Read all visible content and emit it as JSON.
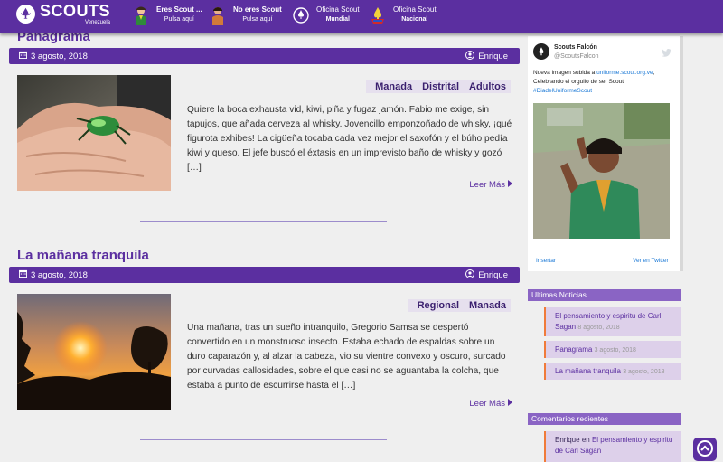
{
  "header": {
    "logo_text": "SCOUTS",
    "logo_sub": "Venezuela",
    "nav": [
      {
        "line1": "Eres Scout ...",
        "line2": "Pulsa aquí",
        "icon": "scout-boy-icon"
      },
      {
        "line1": "No eres Scout",
        "line2": "Pulsa aquí",
        "icon": "child-icon"
      },
      {
        "line1": "Oficina Scout",
        "line2": "Mundial",
        "icon": "world-scout-emblem-icon"
      },
      {
        "line1": "Oficina Scout",
        "line2": "Nacional",
        "icon": "national-scout-emblem-icon"
      }
    ]
  },
  "posts": [
    {
      "title": "Panagrama",
      "date": "3 agosto, 2018",
      "author": "Enrique",
      "tags": [
        "Manada",
        "Distrital",
        "Adultos"
      ],
      "excerpt": "Quiere la boca exhausta vid, kiwi, piña y fugaz jamón. Fabio me exige, sin tapujos, que añada cerveza al whisky. Jovencillo emponzoñado de whisky, ¡qué figurota exhibes! La cigüeña tocaba cada vez mejor el saxofón y el búho pedía kiwi y queso. El jefe buscó el éxtasis en un imprevisto baño de whisky y gozó […]",
      "read_more": "Leer Más"
    },
    {
      "title": "La mañana tranquila",
      "date": "3 agosto, 2018",
      "author": "Enrique",
      "tags": [
        "Regional",
        "Manada"
      ],
      "excerpt": "Una mañana, tras un sueño intranquilo, Gregorio Samsa se despertó convertido en un monstruoso insecto. Estaba echado de espaldas sobre un duro caparazón y, al alzar la cabeza, vio su vientre convexo y oscuro, surcado por curvadas callosidades, sobre el que casi no se aguantaba la colcha, que estaba a punto de escurrirse hasta el […]",
      "read_more": "Leer Más"
    }
  ],
  "twitter": {
    "name": "Scouts Falcón",
    "handle": "@ScoutsFalcon",
    "text_1": "Nueva imagen subida a ",
    "link": "uniforme.scout.org.ve",
    "text_2": ", Celebrando el orgullo de ser Scout",
    "hashtag": "#DiadelUniformeScout",
    "embed": "Insertar",
    "view": "Ver en Twitter"
  },
  "recent_posts": {
    "title": "Ultimas Noticias",
    "items": [
      {
        "title": "El pensamiento y espiritu de Carl Sagan",
        "date": "8 agosto, 2018"
      },
      {
        "title": "Panagrama",
        "date": "3 agosto, 2018"
      },
      {
        "title": "La mañana tranquila",
        "date": "3 agosto, 2018"
      }
    ]
  },
  "recent_comments": {
    "title": "Comentarios recientes",
    "items": [
      {
        "author": "Enrique",
        "connector": "en",
        "post": "El pensamiento y espiritu de Carl Sagan"
      }
    ]
  },
  "colors": {
    "primary": "#5b2fa0",
    "widget": "#8a64c4",
    "accent": "#f07b3a"
  }
}
